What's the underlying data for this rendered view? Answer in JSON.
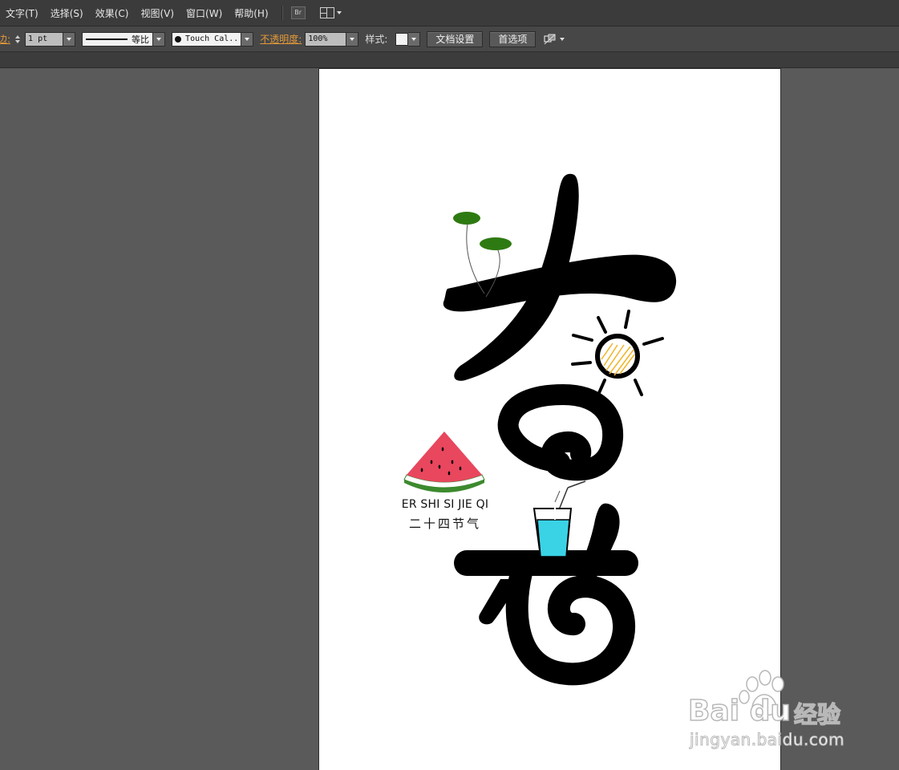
{
  "menubar": {
    "items": [
      {
        "label": "文字(T)"
      },
      {
        "label": "选择(S)"
      },
      {
        "label": "效果(C)"
      },
      {
        "label": "视图(V)"
      },
      {
        "label": "窗口(W)"
      },
      {
        "label": "帮助(H)"
      }
    ],
    "bridge_label": "Br"
  },
  "controlbar": {
    "stroke_label": "边:",
    "stroke_weight": "1 pt",
    "variable_width_profile": "等比",
    "brush": "Touch Cal..",
    "opacity_label": "不透明度:",
    "opacity_value": "100%",
    "style_label": "样式:",
    "document_setup_button": "文档设置",
    "preferences_button": "首选项"
  },
  "artboard": {
    "caption_en": "ER SHI SI JIE QI",
    "caption_zh": "二十四节气"
  },
  "watermark": {
    "logo": "Bai du",
    "brand_cn": "经验",
    "url": "jingyan.baidu.com"
  },
  "colors": {
    "app_bg": "#5a5a5a",
    "menubar_bg": "#3b3b3b",
    "controlbar_bg": "#474747",
    "accent_orange": "#e39a3a",
    "artboard_bg": "#ffffff",
    "glyph_black": "#000000",
    "watermelon_red": "#e8475e",
    "watermelon_green": "#3c8a2e",
    "cup_cyan": "#3ad3e6",
    "sun_yellow": "#f0b429",
    "leaf_green": "#2e7a12"
  },
  "icons": [
    "bridge-icon",
    "arrange-documents-icon",
    "isolate-object-icon"
  ]
}
